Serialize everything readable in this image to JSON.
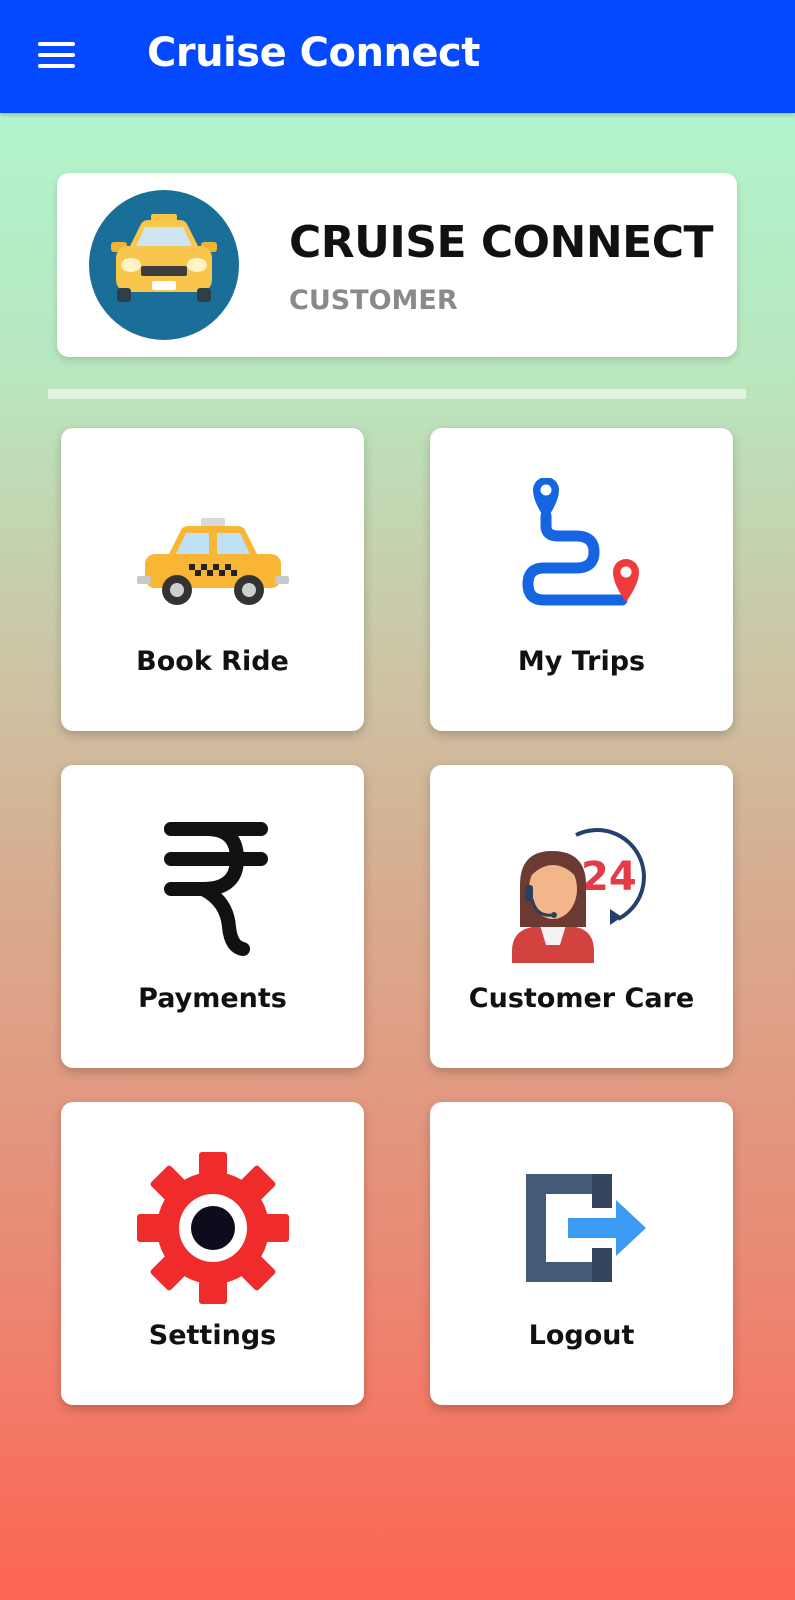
{
  "app_bar": {
    "title": "Cruise Connect",
    "background_color": "#0448ff",
    "menu_icon": "hamburger-menu-icon"
  },
  "profile": {
    "name": "CRUISE CONNECT",
    "role": "CUSTOMER",
    "avatar_icon": "taxi-front-icon"
  },
  "menu_tiles": [
    {
      "label": "Book Ride",
      "icon": "taxi-car-icon"
    },
    {
      "label": "My Trips",
      "icon": "route-map-icon"
    },
    {
      "label": "Payments",
      "icon": "rupee-icon"
    },
    {
      "label": "Customer Care",
      "icon": "support-agent-24-icon"
    },
    {
      "label": "Settings",
      "icon": "gear-icon"
    },
    {
      "label": "Logout",
      "icon": "logout-icon"
    }
  ],
  "colors": {
    "gradient_top": "#affad4",
    "gradient_bottom": "#fd6553",
    "taxi_yellow": "#f9b634",
    "route_blue": "#1565e0",
    "pin_red": "#ee3b3b",
    "gear_red": "#ef2b2b",
    "logout_slate": "#445a78",
    "arrow_blue": "#3d9bf5"
  }
}
